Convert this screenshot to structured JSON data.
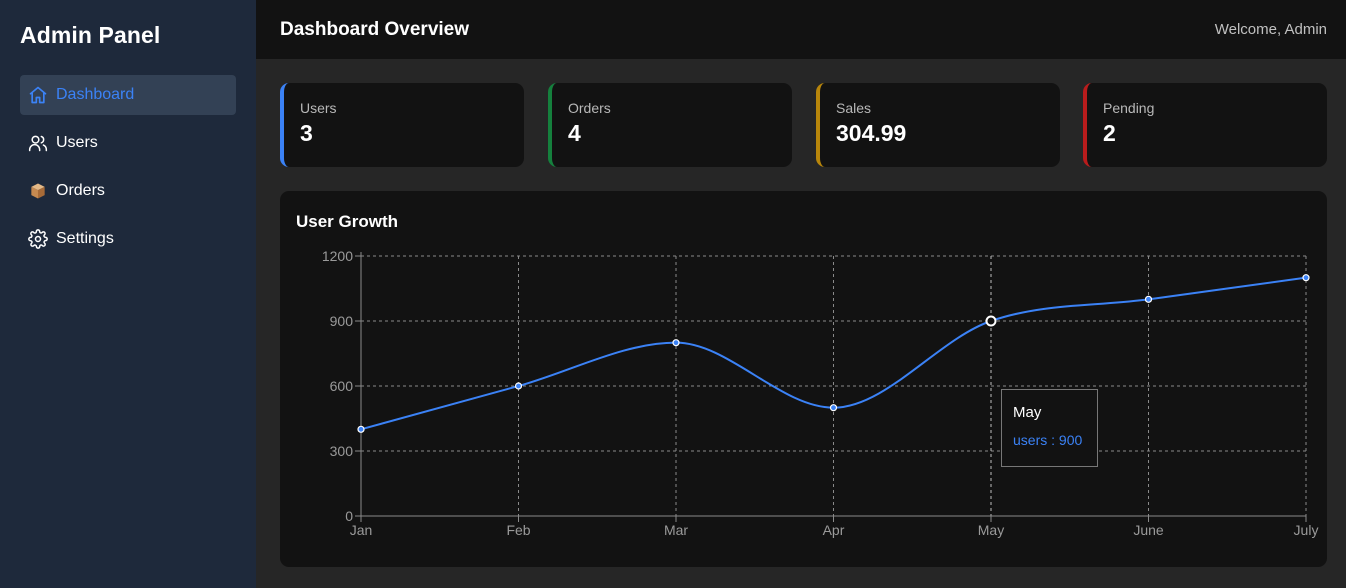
{
  "sidebar": {
    "brand": "Admin Panel",
    "items": [
      {
        "label": "Dashboard",
        "icon": "home-icon",
        "active": true
      },
      {
        "label": "Users",
        "icon": "users-icon",
        "active": false
      },
      {
        "label": "Orders",
        "icon": "package-icon",
        "active": false
      },
      {
        "label": "Settings",
        "icon": "gear-icon",
        "active": false
      }
    ]
  },
  "header": {
    "title": "Dashboard Overview",
    "welcome": "Welcome, Admin"
  },
  "stats": [
    {
      "label": "Users",
      "value": "3",
      "color": "#3b82f6"
    },
    {
      "label": "Orders",
      "value": "4",
      "color": "#15803d"
    },
    {
      "label": "Sales",
      "value": "304.99",
      "color": "#b8860b"
    },
    {
      "label": "Pending",
      "value": "2",
      "color": "#b91c1c"
    }
  ],
  "chart_panel": {
    "title": "User Growth"
  },
  "tooltip": {
    "title": "May",
    "row": "users : 900"
  },
  "colors": {
    "accent": "#3b82f6",
    "sidebar_bg": "#1e293b",
    "panel_bg": "#121212"
  },
  "chart_data": {
    "type": "line",
    "categories": [
      "Jan",
      "Feb",
      "Mar",
      "Apr",
      "May",
      "June",
      "July"
    ],
    "series": [
      {
        "name": "users",
        "values": [
          400,
          600,
          800,
          500,
          900,
          1000,
          1100
        ]
      }
    ],
    "ylim": [
      0,
      1200
    ],
    "yticks": [
      0,
      300,
      600,
      900,
      1200
    ],
    "grid": true,
    "highlighted_category": "May",
    "line_color": "#3b82f6"
  }
}
